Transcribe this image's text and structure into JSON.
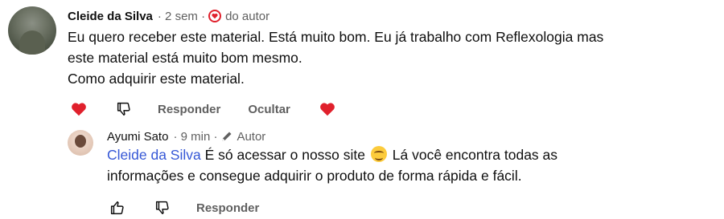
{
  "comments": [
    {
      "author": "Cleide da Silva",
      "time": "· 2 sem ·",
      "badge": "do autor",
      "lines": [
        "Eu quero receber este material. Está muito bom. Eu já trabalho com Reflexologia mas",
        "este material está muito bom mesmo.",
        "Como adquirir este material."
      ],
      "actions": {
        "reply": "Responder",
        "hide": "Ocultar"
      }
    },
    {
      "author": "Ayumi Sato",
      "time": "· 9 min ·",
      "badge": "Autor",
      "mention": "Cleide da Silva",
      "line1_rest_a": " É só acessar o nosso site",
      "line1_rest_b": " Lá você encontra todas as",
      "line2": "informações e consegue adquirir o produto de forma rápida e fácil.",
      "actions": {
        "reply": "Responder"
      }
    }
  ],
  "colors": {
    "heart": "#e0202c",
    "mention": "#3557d6",
    "muted": "#606060"
  }
}
